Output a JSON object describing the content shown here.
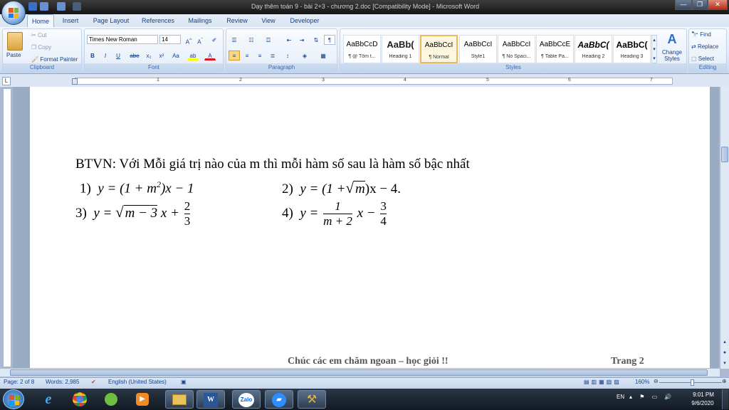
{
  "window": {
    "title": "Dạy thêm toán 9 - bài 2+3 - chương 2.doc [Compatibility Mode] - Microsoft Word",
    "minimize": "—",
    "maximize": "❐",
    "close": "✕"
  },
  "tabs": [
    "Home",
    "Insert",
    "Page Layout",
    "References",
    "Mailings",
    "Review",
    "View",
    "Developer"
  ],
  "ribbon": {
    "clipboard": {
      "label": "Clipboard",
      "paste": "Paste",
      "cut": "Cut",
      "copy": "Copy",
      "format_painter": "Format Painter"
    },
    "font": {
      "label": "Font",
      "family": "Times New Roman",
      "size": "14",
      "bold": "B",
      "italic": "I",
      "underline": "U",
      "strike": "abe",
      "subscript": "x₂",
      "superscript": "x²",
      "change_case": "Aa"
    },
    "paragraph": {
      "label": "Paragraph"
    },
    "styles": {
      "label": "Styles",
      "items": [
        {
          "preview": "AaBbCcD",
          "name": "¶ @ Tôm t..."
        },
        {
          "preview": "AaBb(",
          "name": "Heading 1"
        },
        {
          "preview": "AaBbCcI",
          "name": "¶ Normal"
        },
        {
          "preview": "AaBbCcI",
          "name": "Style1"
        },
        {
          "preview": "AaBbCcI",
          "name": "¶ No Spaci..."
        },
        {
          "preview": "AaBbCcE",
          "name": "¶ Table Pa..."
        },
        {
          "preview": "AaBbC(",
          "name": "Heading 2"
        },
        {
          "preview": "AaBbC(",
          "name": "Heading 3"
        }
      ],
      "change_styles": "Change Styles"
    },
    "editing": {
      "label": "Editing",
      "find": "Find",
      "replace": "Replace",
      "select": "Select"
    }
  },
  "ruler": {
    "numbers": [
      "1",
      "2",
      "3",
      "4",
      "5",
      "6",
      "7"
    ]
  },
  "document": {
    "heading": "BTVN: Với Mỗi giá trị nào của m thì mỗi hàm số sau là hàm số bậc nhất",
    "p1_num": "1)",
    "p1_a": "y = (1 + m",
    "p1_sup": "2",
    "p1_b": ")x − 1",
    "p2_num": "2)",
    "p2_a": "y = (1 +",
    "p2_rad": "m",
    "p2_b": ")x − 4.",
    "p3_num": "3)",
    "p3_a": "y =",
    "p3_rad": "m − 3",
    "p3_b": "x +",
    "p3_frac_num": "2",
    "p3_frac_den": "3",
    "p4_num": "4)",
    "p4_a": "y =",
    "p4_frac1_num": "1",
    "p4_frac1_den": "m + 2",
    "p4_b": "x −",
    "p4_frac2_num": "3",
    "p4_frac2_den": "4",
    "footer_text": "Chúc các em chăm  ngoan – học giỏi !!",
    "footer_page": "Trang  2"
  },
  "status": {
    "page": "Page: 2 of 8",
    "words": "Words: 2,985",
    "language": "English (United States)",
    "zoom": "160%"
  },
  "taskbar": {
    "zalo": "Zalo",
    "lang": "EN",
    "time": "9:01 PM",
    "date": "9/6/2020"
  }
}
